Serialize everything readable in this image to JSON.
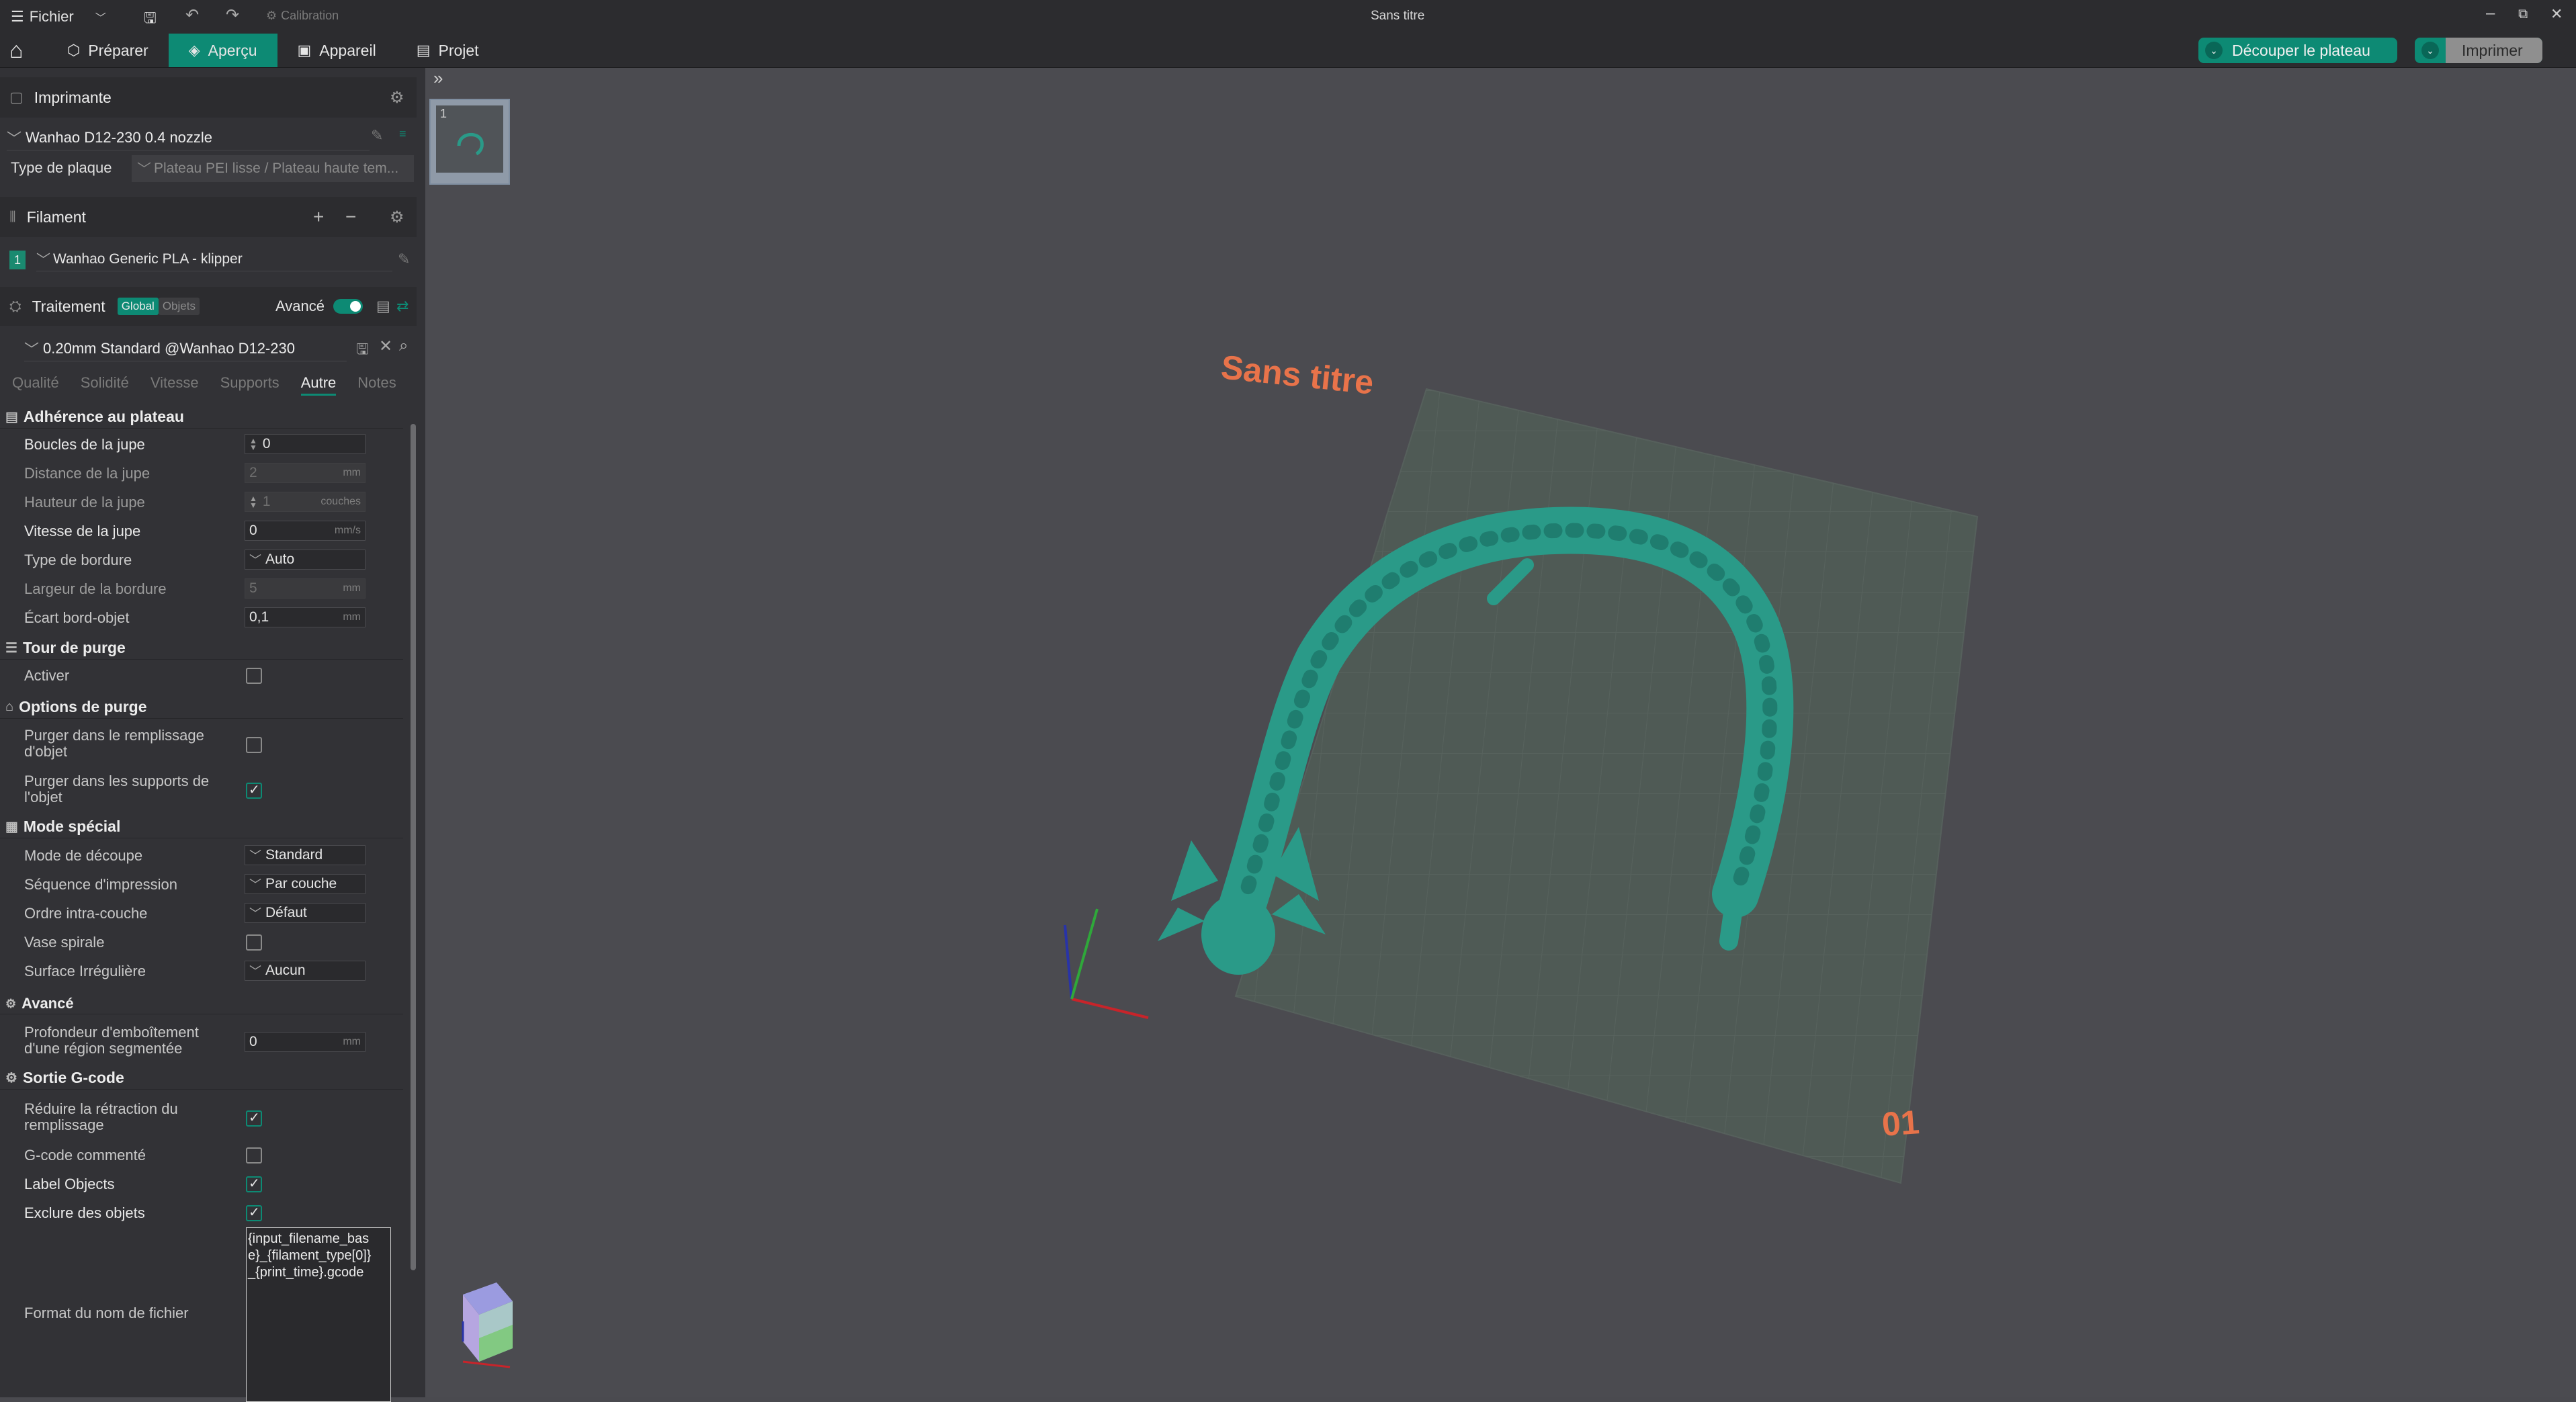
{
  "titlebar": {
    "menu_label": "Fichier",
    "calibration_label": "Calibration",
    "window_title": "Sans titre"
  },
  "tabs": [
    {
      "label": "Préparer"
    },
    {
      "label": "Aperçu"
    },
    {
      "label": "Appareil"
    },
    {
      "label": "Projet"
    }
  ],
  "actions": {
    "slice_label": "Découper le plateau",
    "print_label": "Imprimer"
  },
  "printer": {
    "section_title": "Imprimante",
    "printer_name": "Wanhao D12-230 0.4 nozzle",
    "plate_type_label": "Type de plaque",
    "plate_type_value": "Plateau PEI lisse / Plateau haute tem..."
  },
  "filament": {
    "section_title": "Filament",
    "slot_number": "1",
    "name": "Wanhao Generic PLA - klipper",
    "slot_color": "#1a8a70"
  },
  "process": {
    "section_title": "Traitement",
    "badge_global": "Global",
    "badge_objects": "Objets",
    "advanced_label": "Avancé",
    "preset_name": "0.20mm Standard @Wanhao D12-230",
    "tabs": [
      "Qualité",
      "Solidité",
      "Vitesse",
      "Supports",
      "Autre",
      "Notes"
    ]
  },
  "settings": {
    "adhesion": {
      "title": "Adhérence au plateau",
      "skirt_loops_label": "Boucles de la jupe",
      "skirt_loops_value": "0",
      "skirt_distance_label": "Distance de la jupe",
      "skirt_distance_value": "2",
      "skirt_distance_unit": "mm",
      "skirt_height_label": "Hauteur de la jupe",
      "skirt_height_value": "1",
      "skirt_height_unit": "couches",
      "skirt_speed_label": "Vitesse de la jupe",
      "skirt_speed_value": "0",
      "skirt_speed_unit": "mm/s",
      "brim_type_label": "Type de bordure",
      "brim_type_value": "Auto",
      "brim_width_label": "Largeur de la bordure",
      "brim_width_value": "5",
      "brim_width_unit": "mm",
      "brim_gap_label": "Écart bord-objet",
      "brim_gap_value": "0,1",
      "brim_gap_unit": "mm"
    },
    "prime_tower": {
      "title": "Tour de purge",
      "enable_label": "Activer"
    },
    "purge": {
      "title": "Options de purge",
      "infill_label": "Purger dans le remplissage d'objet",
      "support_label": "Purger dans les supports de l'objet"
    },
    "special": {
      "title": "Mode spécial",
      "slicing_mode_label": "Mode de découpe",
      "slicing_mode_value": "Standard",
      "print_sequence_label": "Séquence d'impression",
      "print_sequence_value": "Par couche",
      "intra_layer_label": "Ordre intra-couche",
      "intra_layer_value": "Défaut",
      "spiral_vase_label": "Vase spirale",
      "fuzzy_skin_label": "Surface Irrégulière",
      "fuzzy_skin_value": "Aucun"
    },
    "advanced": {
      "title": "Avancé",
      "interlocking_label": "Profondeur d'emboîtement d'une région segmentée",
      "interlocking_value": "0",
      "interlocking_unit": "mm"
    },
    "gcode": {
      "title": "Sortie G-code",
      "reduce_retraction_label": "Réduire la rétraction du remplissage",
      "commented_gcode_label": "G-code commenté",
      "label_objects_label": "Label Objects",
      "exclude_objects_label": "Exclure des objets",
      "filename_format_label": "Format du nom de fichier",
      "filename_format_value": "{input_filename_base}_{filament_type[0]}_{print_time}.gcode"
    }
  },
  "viewport": {
    "plate_name": "Sans titre",
    "plate_number": "01",
    "thumbnail_number": "1",
    "accent_color": "#e8734a",
    "model_color": "#2a9a88"
  }
}
